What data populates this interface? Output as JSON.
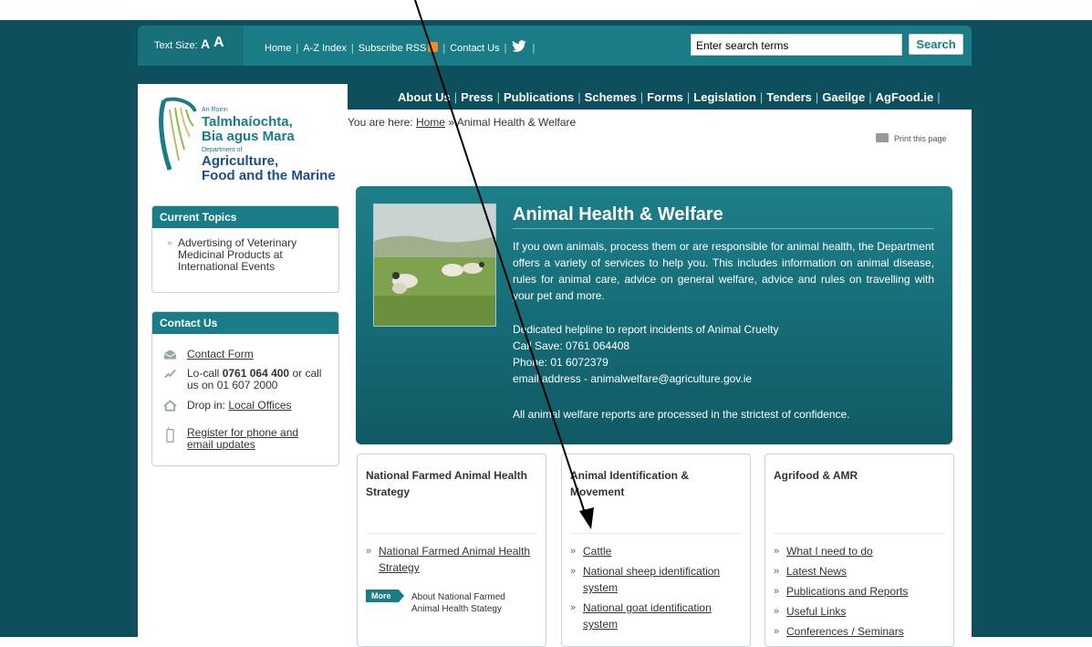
{
  "top_bar": {
    "text_size_label": "Text Size:",
    "text_size_small": "A",
    "text_size_large": "A",
    "links": [
      "Home",
      "A-Z Index",
      "Subscribe RSS",
      "Contact Us"
    ],
    "search_value": "Enter search terms",
    "search_button": "Search"
  },
  "main_nav": [
    "About Us",
    "Press",
    "Publications",
    "Schemes",
    "Forms",
    "Legislation",
    "Tenders",
    "Gaeilge",
    "AgFood.ie"
  ],
  "logo": {
    "line1": "An Roinn",
    "line2": "Talmhaíochta,",
    "line3": "Bia agus Mara",
    "line4": "Department of",
    "line5": "Agriculture,",
    "line6": "Food and the Marine"
  },
  "breadcrumb": {
    "prefix": "You are here:",
    "home": "Home",
    "sep": "»",
    "current": "Animal Health & Welfare"
  },
  "print_label": "Print this page",
  "current_topics": {
    "title": "Current Topics",
    "items": [
      "Advertising of Veterinary Medicinal Products at International Events"
    ]
  },
  "contact": {
    "title": "Contact Us",
    "form_link": "Contact Form",
    "locall_prefix": "Lo-call",
    "locall_number": "0761 064 400",
    "locall_suffix": "or call",
    "locall_line2": "us on 01 607 2000",
    "dropin_prefix": "Drop in:",
    "dropin_link": "Local Offices",
    "register_line1": "Register for phone and",
    "register_line2": "email updates"
  },
  "hero": {
    "title": "Animal Health & Welfare",
    "description": "If you own animals, process them or are responsible for animal health, the Department offers a variety of services to help you. This includes information on animal disease, rules for animal care, advice on general welfare, advice and rules on travelling with your pet and more.",
    "helpline": "Dedicated helpline to report incidents of Animal Cruelty",
    "callsave": "Call Save: 0761 064408",
    "phone": "Phone: 01 6072379",
    "email": "email address - animalwelfare@agriculture.gov.ie",
    "confidence": "All animal welfare reports are processed in the strictest of confidence."
  },
  "columns": [
    {
      "title": "National Farmed Animal Health Strategy",
      "links": [
        "National Farmed Animal Health Strategy"
      ],
      "more_badge": "More",
      "more_text": "About National Farmed Animal Health Stategy"
    },
    {
      "title": "Animal Identification & Movement",
      "links": [
        "Cattle",
        "National sheep identification system",
        "National goat identification system"
      ]
    },
    {
      "title": "Agrifood & AMR",
      "links": [
        "What I need to do",
        "Latest News",
        "Publications and Reports",
        "Useful Links",
        "Conferences / Seminars"
      ]
    }
  ]
}
